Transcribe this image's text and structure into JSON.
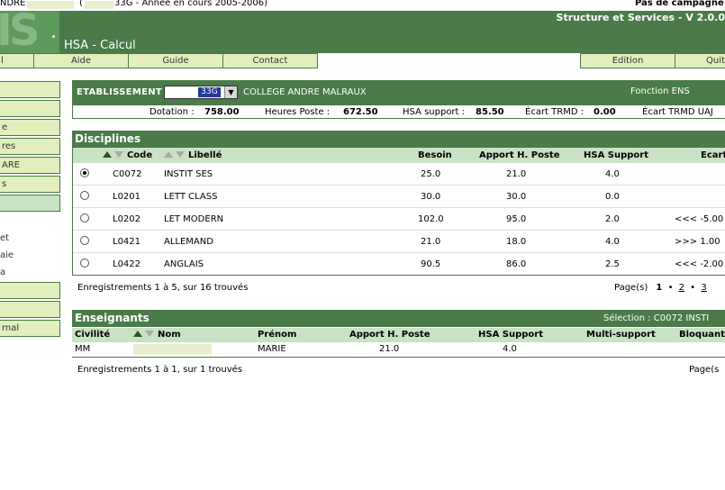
{
  "top_strip": {
    "left_text": "NDRE",
    "paren_open": "(",
    "year_text": "33G - Année en cours 2005-2006)",
    "campaign": "Pas de campagne"
  },
  "header": {
    "logo_text": "IS",
    "app_title": "HSA - Calcul",
    "version": "Structure et Services - V 2.0.0"
  },
  "menu": {
    "items": [
      "l",
      "Aide",
      "Guide",
      "Contact"
    ],
    "right_items": [
      "Edition",
      "Quit"
    ]
  },
  "sidebar": {
    "buttons": [
      "",
      "",
      "e",
      "res",
      "ARE",
      "s",
      ""
    ],
    "texts": [
      "et",
      "aie",
      "a"
    ],
    "buttons2": [
      "",
      "",
      "rnal"
    ]
  },
  "etablissement": {
    "label": "ETABLISSEMENT",
    "selected_code": "33G",
    "name": "COLLEGE ANDRE MALRAUX",
    "fonction": "Fonction ENS"
  },
  "dotation": {
    "dotation_label": "Dotation :",
    "dotation_value": "758.00",
    "heures_label": "Heures Poste :",
    "heures_value": "672.50",
    "hsa_label": "HSA support :",
    "hsa_value": "85.50",
    "trmd_label": "Écart TRMD :",
    "trmd_value": "0.00",
    "trmd_uaj_label": "Écart TRMD UAJ"
  },
  "disciplines": {
    "title": "Disciplines",
    "headers": {
      "code": "Code",
      "libelle": "Libellé",
      "besoin": "Besoin",
      "apport": "Apport H. Poste",
      "hsa": "HSA Support",
      "ecart": "Ecart"
    },
    "rows": [
      {
        "code": "C0072",
        "libelle": "INSTIT SES",
        "besoin": "25.0",
        "apport": "21.0",
        "hsa": "4.0",
        "ecart": "",
        "selected": true
      },
      {
        "code": "L0201",
        "libelle": "LETT CLASS",
        "besoin": "30.0",
        "apport": "30.0",
        "hsa": "0.0",
        "ecart": "",
        "selected": false
      },
      {
        "code": "L0202",
        "libelle": "LET MODERN",
        "besoin": "102.0",
        "apport": "95.0",
        "hsa": "2.0",
        "ecart": "<<< -5.00",
        "selected": false
      },
      {
        "code": "L0421",
        "libelle": "ALLEMAND",
        "besoin": "21.0",
        "apport": "18.0",
        "hsa": "4.0",
        "ecart": ">>> 1.00",
        "selected": false
      },
      {
        "code": "L0422",
        "libelle": "ANGLAIS",
        "besoin": "90.5",
        "apport": "86.0",
        "hsa": "2.5",
        "ecart": "<<< -2.00",
        "selected": false
      }
    ],
    "records_text": "Enregistrements 1 à 5, sur 16 trouvés",
    "pages_label": "Page(s)",
    "page_current": "1",
    "page_2": "2",
    "page_3": "3",
    "bullet": "•"
  },
  "enseignants": {
    "title": "Enseignants",
    "selection": "Sélection : C0072 INSTI",
    "headers": {
      "civilite": "Civilité",
      "nom": "Nom",
      "prenom": "Prénom",
      "apport": "Apport H. Poste",
      "hsa": "HSA Support",
      "multi": "Multi-support",
      "bloquant": "Bloquant"
    },
    "row": {
      "civilite": "MM",
      "prenom": "MARIE",
      "apport": "21.0",
      "hsa": "4.0"
    },
    "records_text": "Enregistrements 1 à 1, sur 1 trouvés",
    "pages_label": "Page(s"
  },
  "colors": {
    "header_green": "#4a7b49",
    "menu_bg": "#e2eebc",
    "table_head_bg": "#c8e2c4",
    "select_highlight": "#1f3a98"
  }
}
